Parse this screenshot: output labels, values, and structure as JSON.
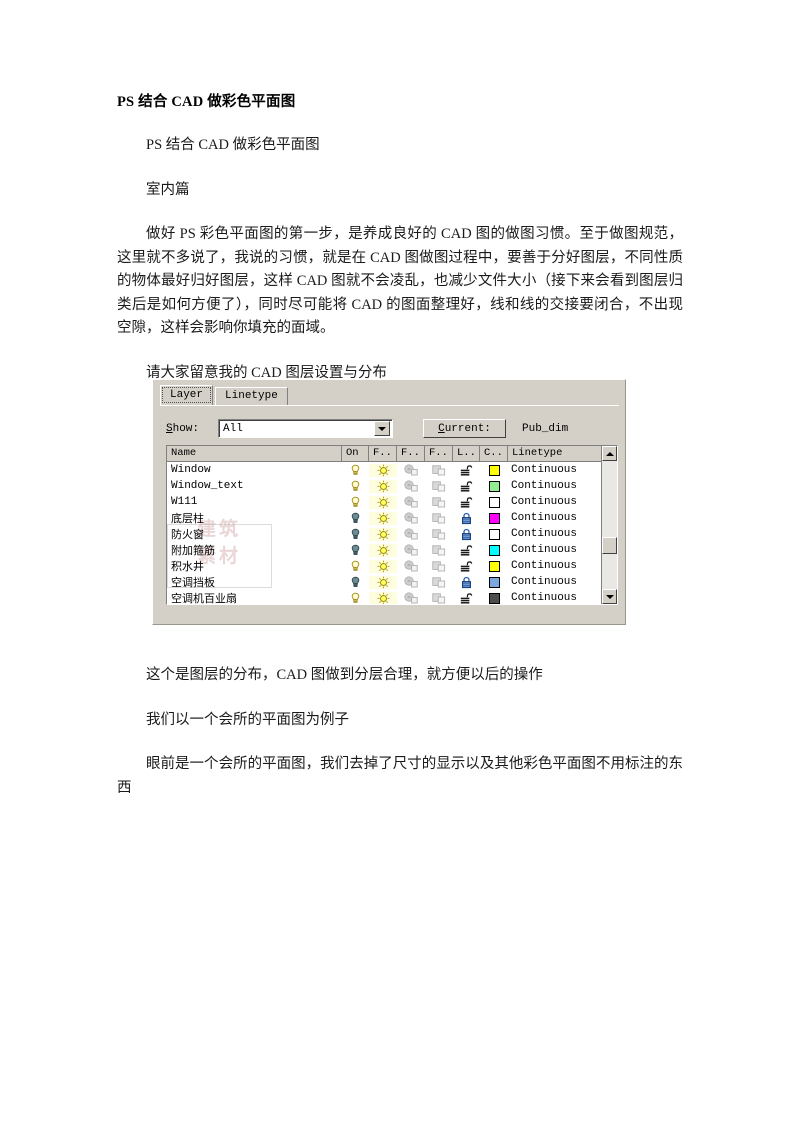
{
  "document": {
    "title": "PS 结合 CAD 做彩色平面图",
    "paragraphs": [
      "PS 结合 CAD 做彩色平面图",
      "室内篇",
      "做好 PS 彩色平面图的第一步，是养成良好的 CAD 图的做图习惯。至于做图规范，这里就不多说了，我说的习惯，就是在 CAD 图做图过程中，要善于分好图层，不同性质的物体最好归好图层，这样 CAD 图就不会凌乱，也减少文件大小（接下来会看到图层归类后是如何方便了），同时尽可能将 CAD 的图面整理好，线和线的交接要闭合，不出现空隙，这样会影响你填充的面域。",
      "请大家留意我的 CAD 图层设置与分布"
    ],
    "paragraphs_after": [
      "这个是图层的分布，CAD 图做到分层合理，就方便以后的操作",
      "我们以一个会所的平面图为例子",
      "眼前是一个会所的平面图，我们去掉了尺寸的显示以及其他彩色平面图不用标注的东西"
    ]
  },
  "layer_dialog": {
    "tabs": [
      {
        "label": "Layer",
        "active": true
      },
      {
        "label": "Linetype",
        "active": false
      }
    ],
    "show_label": "Show:",
    "show_value": "All",
    "current_button": "Current:",
    "current_value": "Pub_dim",
    "columns": [
      "Name",
      "On",
      "F..",
      "F..",
      "F..",
      "L..",
      "C..",
      "Linetype"
    ],
    "rows": [
      {
        "name": "Window",
        "on": "on",
        "freeze": "sun",
        "f2": "freeze-vp",
        "f3": "freeze-newvp",
        "lock": "unlocked",
        "color": "#ffff00",
        "linetype": "Continuous"
      },
      {
        "name": "Window_text",
        "on": "on",
        "freeze": "sun",
        "f2": "freeze-vp",
        "f3": "freeze-newvp",
        "lock": "unlocked",
        "color": "#90ee90",
        "linetype": "Continuous"
      },
      {
        "name": "W111",
        "on": "on",
        "freeze": "sun",
        "f2": "freeze-vp",
        "f3": "freeze-newvp",
        "lock": "unlocked",
        "color": "#ffffff",
        "linetype": "Continuous"
      },
      {
        "name": "底层柱",
        "on": "off",
        "freeze": "sun",
        "f2": "freeze-vp",
        "f3": "freeze-newvp",
        "lock": "locked",
        "color": "#ff00ff",
        "linetype": "Continuous"
      },
      {
        "name": "防火窗",
        "on": "off",
        "freeze": "sun",
        "f2": "freeze-vp",
        "f3": "freeze-newvp",
        "lock": "locked",
        "color": "#ffffff",
        "linetype": "Continuous"
      },
      {
        "name": "附加箍筋",
        "on": "off",
        "freeze": "sun",
        "f2": "freeze-vp",
        "f3": "freeze-newvp",
        "lock": "unlocked",
        "color": "#00ffff",
        "linetype": "Continuous"
      },
      {
        "name": "积水井",
        "on": "on",
        "freeze": "sun",
        "f2": "freeze-vp",
        "f3": "freeze-newvp",
        "lock": "unlocked",
        "color": "#ffff00",
        "linetype": "Continuous"
      },
      {
        "name": "空调挡板",
        "on": "off",
        "freeze": "sun",
        "f2": "freeze-vp",
        "f3": "freeze-newvp",
        "lock": "locked",
        "color": "#7aa8dc",
        "linetype": "Continuous"
      },
      {
        "name": "空调机百业扇",
        "on": "on",
        "freeze": "sun",
        "f2": "freeze-vp",
        "f3": "freeze-newvp",
        "lock": "unlocked",
        "color": "#4d4d4d",
        "linetype": "Continuous"
      }
    ],
    "scrollbar": {
      "up": "scroll-up",
      "down": "scroll-down"
    }
  }
}
